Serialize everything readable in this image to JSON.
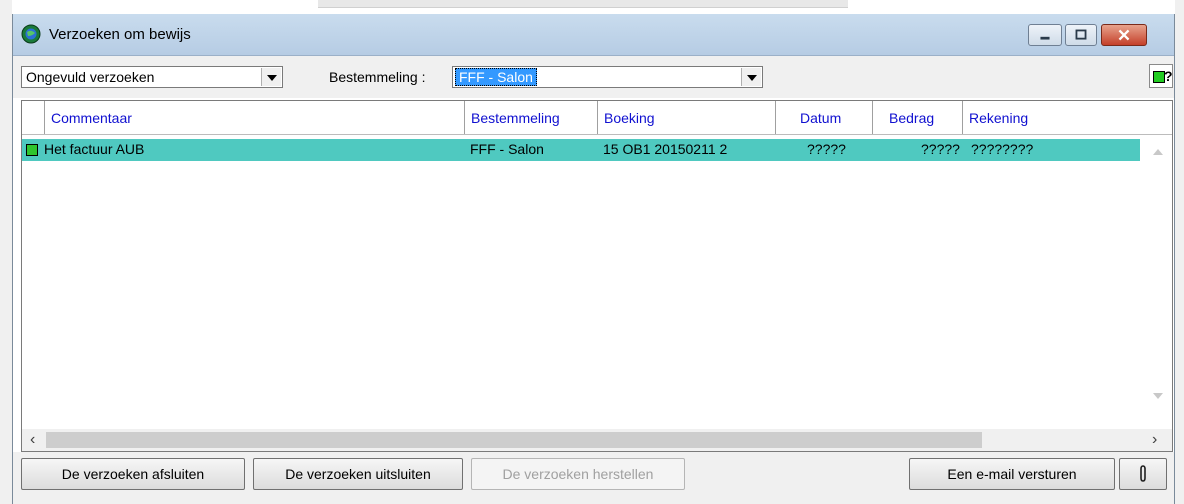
{
  "window": {
    "title": "Verzoeken om bewijs"
  },
  "toolbar": {
    "filter_value": "Ongevuld verzoeken",
    "destination_label": "Bestemmeling :",
    "destination_value": "FFF - Salon",
    "help_label": "?"
  },
  "table": {
    "columns": [
      "Commentaar",
      "Bestemmeling",
      "Boeking",
      "Datum",
      "Bedrag",
      "Rekening"
    ],
    "rows": [
      {
        "commentaar": "Het factuur AUB",
        "bestemmeling": "FFF - Salon",
        "boeking": "15 OB1 20150211 2",
        "datum": "?????",
        "bedrag": "?????",
        "rekening": "????????",
        "selected": true
      }
    ]
  },
  "buttons": {
    "close_requests": "De verzoeken afsluiten",
    "exclude_requests": "De verzoeken uitsluiten",
    "restore_requests": "De verzoeken herstellen",
    "send_email": "Een e-mail versturen",
    "attach_icon": "paperclip-icon"
  },
  "colors": {
    "selected_row": "#4fc9c0",
    "header_text": "#1010d0",
    "status_square": "#2fc52f",
    "close_button": "#c4402a"
  }
}
